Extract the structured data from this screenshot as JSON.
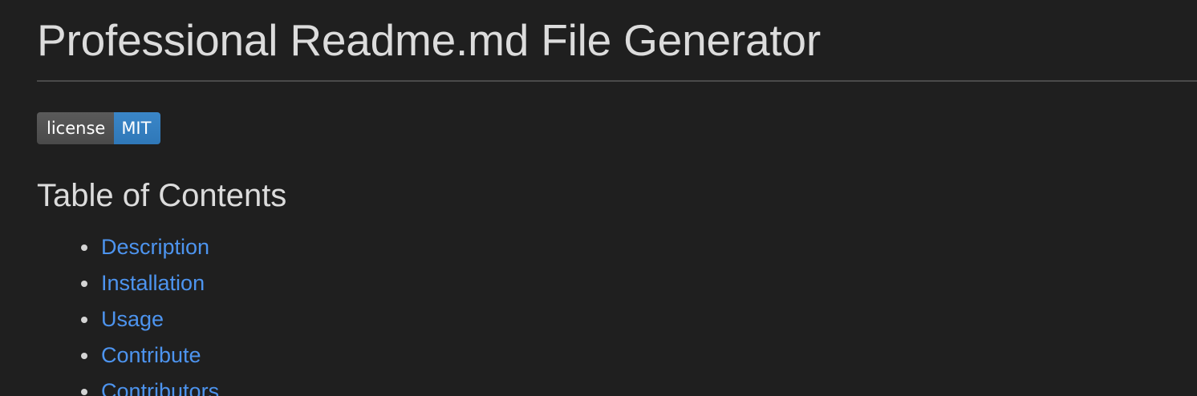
{
  "document": {
    "title": "Professional Readme.md File Generator",
    "badge": {
      "label": "license",
      "value": "MIT",
      "label_color": "#555555",
      "value_color": "#3380c2"
    },
    "toc": {
      "heading": "Table of Contents",
      "items": [
        {
          "label": "Description"
        },
        {
          "label": "Installation"
        },
        {
          "label": "Usage"
        },
        {
          "label": "Contribute"
        },
        {
          "label": "Contributors"
        }
      ]
    }
  },
  "colors": {
    "background": "#1f1f1f",
    "text": "#dcdcdc",
    "link": "#4d94ef"
  }
}
